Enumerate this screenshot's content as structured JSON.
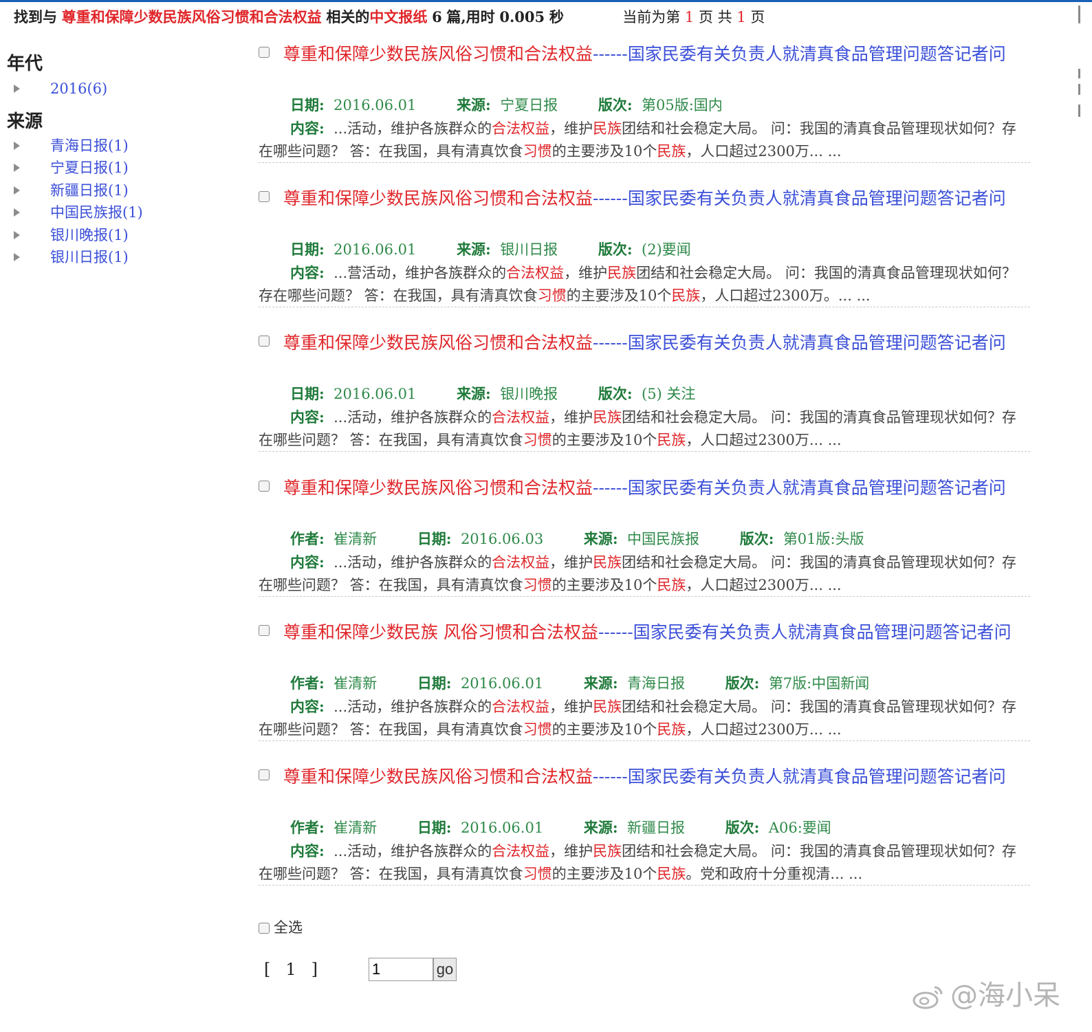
{
  "header": {
    "prefix": "找到与",
    "query": "尊重和保障少数民族风俗习惯和合法权益",
    "mid": "相关的",
    "category": "中文报纸",
    "count": "6",
    "suffix": "篇,用时",
    "time": "0.005",
    "sec": "秒",
    "page_prefix": "当前为第",
    "current_page": "1",
    "page_mid": "页 共",
    "total_pages": "1",
    "page_suffix": "页"
  },
  "sidebar": {
    "year_heading": "年代",
    "years": [
      {
        "label": "2016(6)"
      }
    ],
    "source_heading": "来源",
    "sources": [
      {
        "label": "青海日报(1)"
      },
      {
        "label": "宁夏日报(1)"
      },
      {
        "label": "新疆日报(1)"
      },
      {
        "label": "中国民族报(1)"
      },
      {
        "label": "银川晚报(1)"
      },
      {
        "label": "银川日报(1)"
      }
    ]
  },
  "labels": {
    "author": "作者:",
    "date": "日期:",
    "source": "来源:",
    "edition": "版次:",
    "content": "内容:"
  },
  "results": [
    {
      "title_kw": "尊重和保障少数民族风俗习惯和合法权益",
      "title_rest": "------国家民委有关负责人就清真食品管理问题答记者问",
      "author": "",
      "date": "2016.06.01",
      "source": "宁夏日报",
      "edition": "第05版:国内",
      "c": [
        "...活动，维护各族群众的",
        "合法权益",
        "，维护",
        "民族",
        "团结和社会稳定大局。 问：我国的清真食品管理现状如何？存在哪些问题？ 答：在我国，具有清真饮食",
        "习惯",
        "的主要涉及10个",
        "民族",
        "，人口超过2300万... ..."
      ]
    },
    {
      "title_kw": "尊重和保障少数民族风俗习惯和合法权益",
      "title_rest": "------国家民委有关负责人就清真食品管理问题答记者问",
      "author": "",
      "date": "2016.06.01",
      "source": "银川日报",
      "edition": "(2)要闻",
      "c": [
        "...营活动，维护各族群众的",
        "合法权益",
        "，维护",
        "民族",
        "团结和社会稳定大局。 问：我国的清真食品管理现状如何？存在哪些问题？ 答：在我国，具有清真饮食",
        "习惯",
        "的主要涉及10个",
        "民族",
        "，人口超过2300万。... ..."
      ]
    },
    {
      "title_kw": "尊重和保障少数民族风俗习惯和合法权益",
      "title_rest": "------国家民委有关负责人就清真食品管理问题答记者问",
      "author": "",
      "date": "2016.06.01",
      "source": "银川晚报",
      "edition": "(5) 关注",
      "c": [
        "...活动，维护各族群众的",
        "合法权益",
        "，维护",
        "民族",
        "团结和社会稳定大局。 问：我国的清真食品管理现状如何？存在哪些问题？ 答：在我国，具有清真饮食",
        "习惯",
        "的主要涉及10个",
        "民族",
        "，人口超过2300万... ..."
      ]
    },
    {
      "title_kw": "尊重和保障少数民族风俗习惯和合法权益",
      "title_rest": "------国家民委有关负责人就清真食品管理问题答记者问",
      "author": "崔清新",
      "date": "2016.06.03",
      "source": "中国民族报",
      "edition": "第01版:头版",
      "c": [
        "...活动，维护各族群众的",
        "合法权益",
        "，维护",
        "民族",
        "团结和社会稳定大局。 问：我国的清真食品管理现状如何？存在哪些问题？ 答：在我国，具有清真饮食",
        "习惯",
        "的主要涉及10个",
        "民族",
        "，人口超过2300万... ..."
      ]
    },
    {
      "title_kw": "尊重和保障少数民族 风俗习惯和合法权益",
      "title_rest": "------国家民委有关负责人就清真食品管理问题答记者问",
      "author": "崔清新",
      "date": "2016.06.01",
      "source": "青海日报",
      "edition": "第7版:中国新闻",
      "c": [
        "...活动，维护各族群众的",
        "合法权益",
        "，维护",
        "民族",
        "团结和社会稳定大局。 问：我国的清真食品管理现状如何？存在哪些问题？ 答：在我国，具有清真饮食",
        "习惯",
        "的主要涉及10个",
        "民族",
        "，人口超过2300万... ..."
      ]
    },
    {
      "title_kw": "尊重和保障少数民族风俗习惯和合法权益",
      "title_rest": "------国家民委有关负责人就清真食品管理问题答记者问",
      "author": "崔清新",
      "date": "2016.06.01",
      "source": "新疆日报",
      "edition": "A06:要闻",
      "c": [
        "...活动，维护各族群众的",
        "合法权益",
        "，维护",
        "民族",
        "团结和社会稳定大局。 问：我国的清真食品管理现状如何？存在哪些问题？ 答：在我国，具有清真饮食",
        "习惯",
        "的主要涉及10个",
        "民族",
        "。党和政府十分重视清... ..."
      ]
    }
  ],
  "footer": {
    "select_all": "全选",
    "pager_open": "[",
    "pager_page": "1",
    "pager_close": "]",
    "page_input_value": "1",
    "go_label": "go"
  },
  "watermark": "@海小呆",
  "colors": {
    "keyword_red": "#e0262a",
    "link_blue": "#3b4fd8",
    "meta_green": "#1f7a3a"
  }
}
